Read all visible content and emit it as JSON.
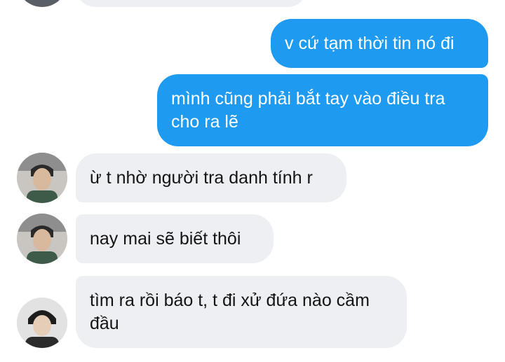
{
  "messages": [
    {
      "direction": "in",
      "text": "",
      "partial": true
    },
    {
      "direction": "out",
      "text": "v cứ tạm thời tin nó đi"
    },
    {
      "direction": "out",
      "text": "mình cũng phải bắt tay vào điều tra cho ra lẽ"
    },
    {
      "direction": "in",
      "text": "ừ t nhờ người tra danh tính r"
    },
    {
      "direction": "in",
      "text": "nay mai sẽ biết thôi"
    },
    {
      "direction": "in",
      "text": "tìm ra rồi báo t, t đi xử đứa nào cầm đầu"
    }
  ],
  "colors": {
    "outgoing_bubble": "#1e9bf0",
    "incoming_bubble": "#eeeff3",
    "incoming_text": "#141414",
    "outgoing_text": "#ffffff"
  },
  "icons": {
    "avatar_a": "contact-photo-avatar",
    "avatar_b": "contact-photo-avatar"
  }
}
